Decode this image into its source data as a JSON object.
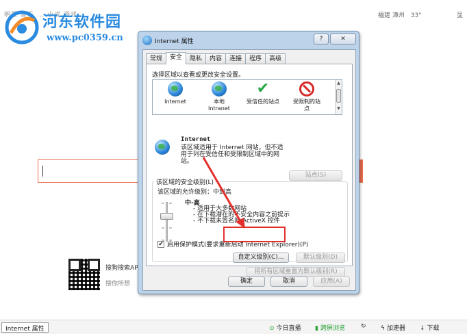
{
  "browser": {
    "topnav": "明星   音乐   ...   小说   游戏",
    "weather": {
      "location": "福建 漳州",
      "temp": "33°"
    },
    "top_right": "显"
  },
  "watermark": {
    "title": "河东软件园",
    "url": "www.pc0359.cn"
  },
  "promo": {
    "title": "搜狗搜索AP",
    "subtitle": "搜你所想"
  },
  "statusbar": {
    "task": "Internet 属性",
    "items": [
      "今日直播",
      "跨屏浏览",
      "",
      "加速器",
      "下载"
    ]
  },
  "dialog": {
    "title": "Internet 属性",
    "help": "?",
    "close": "✕",
    "tabs": [
      "常规",
      "安全",
      "隐私",
      "内容",
      "连接",
      "程序",
      "高级"
    ],
    "active_tab": "安全",
    "zone_prompt": "选择区域以查看或更改安全设置。",
    "zones": [
      {
        "label": "Internet",
        "icon": "globe-icon"
      },
      {
        "label": "本地\nIntranet",
        "icon": "intranet-icon"
      },
      {
        "label": "受信任的站点",
        "icon": "checkmark-icon"
      },
      {
        "label": "受限制的站\n点",
        "icon": "no-entry-icon"
      }
    ],
    "zone_name": "Internet",
    "zone_desc": "该区域适用于 Internet 网站，但不适用于列在受信任和受限制区域中的网站。",
    "sites_button": "站点(S)",
    "group_label": "该区域的安全级别(L)",
    "allowed_levels": "该区域的允许级别：中到高",
    "level_name": "中-高",
    "level_bullets": [
      "- 适用于大多数网站",
      "- 在下载潜在的不安全内容之前提示",
      "- 不下载未签名的 ActiveX 控件"
    ],
    "protected_mode": "启用保护模式(要求重新启动 Internet Explorer)(P)",
    "protected_checked": "✔",
    "custom_level": "自定义级别(C)...",
    "default_level": "默认级别(D)",
    "reset_all": "将所有区域重置为默认级别(R)",
    "ok": "确定",
    "cancel": "取消",
    "apply": "应用(A)"
  },
  "accent_colors": {
    "highlight": "#e3302c",
    "watermark": "#2a8be0"
  }
}
